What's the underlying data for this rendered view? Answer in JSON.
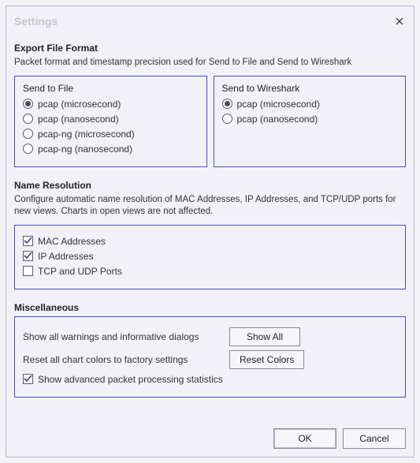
{
  "window": {
    "title": "Settings"
  },
  "export": {
    "heading": "Export File Format",
    "desc": "Packet format and timestamp precision used for Send to File and Send to Wireshark",
    "file_group": {
      "title": "Send to File",
      "selected": "pcap_us",
      "options": [
        {
          "id": "pcap_us",
          "label": "pcap (microsecond)"
        },
        {
          "id": "pcap_ns",
          "label": "pcap (nanosecond)"
        },
        {
          "id": "pcapng_us",
          "label": "pcap-ng (microsecond)"
        },
        {
          "id": "pcapng_ns",
          "label": "pcap-ng (nanosecond)"
        }
      ]
    },
    "wireshark_group": {
      "title": "Send to Wireshark",
      "selected": "pcap_us",
      "options": [
        {
          "id": "pcap_us",
          "label": "pcap (microsecond)"
        },
        {
          "id": "pcap_ns",
          "label": "pcap (nanosecond)"
        }
      ]
    }
  },
  "nameres": {
    "heading": "Name Resolution",
    "desc": "Configure automatic name resolution of MAC Addresses, IP Addresses, and TCP/UDP ports for new views. Charts in open views are not affected.",
    "items": [
      {
        "id": "mac",
        "label": "MAC Addresses",
        "checked": true
      },
      {
        "id": "ip",
        "label": "IP Addresses",
        "checked": true
      },
      {
        "id": "ports",
        "label": "TCP and UDP Ports",
        "checked": false
      }
    ]
  },
  "misc": {
    "heading": "Miscellaneous",
    "show_warnings_label": "Show all warnings and informative dialogs",
    "show_warnings_button": "Show All",
    "reset_colors_label": "Reset all chart colors to factory settings",
    "reset_colors_button": "Reset Colors",
    "stats": {
      "label": "Show advanced packet processing statistics",
      "checked": true
    }
  },
  "footer": {
    "ok": "OK",
    "cancel": "Cancel"
  }
}
